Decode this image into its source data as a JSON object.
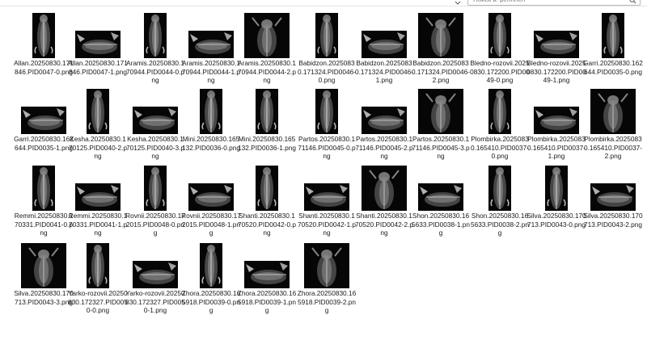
{
  "search": {
    "placeholder": "Поиск в: pennrien"
  },
  "files": [
    {
      "name": "Allan.20250830.171846.PID0047-0.png",
      "view": "v"
    },
    {
      "name": "Allan.20250830.171846.PID0047-1.png",
      "view": "h"
    },
    {
      "name": "Aramis.20250830.170944.PID0044-0.png",
      "view": "v"
    },
    {
      "name": "Aramis.20250830.170944.PID0044-1.png",
      "view": "h"
    },
    {
      "name": "Aramis.20250830.170944.PID0044-2.png",
      "view": "s"
    },
    {
      "name": "Babidzon.20250830.171324.PID0046-0.png",
      "view": "v"
    },
    {
      "name": "Babidzon.20250830.171324.PID0046-1.png",
      "view": "h"
    },
    {
      "name": "Babidzon.20250830.171324.PID0046-2.png",
      "view": "s"
    },
    {
      "name": "Bledno-rozovii.20250830.172200.PID0049-0.png",
      "view": "v"
    },
    {
      "name": "Bledno-rozovii.20250830.172200.PID0049-1.png",
      "view": "h"
    },
    {
      "name": "Garri.20250830.162644.PID0035-0.png",
      "view": "v"
    },
    {
      "name": "Garri.20250830.162644.PID0035-1.png",
      "view": "h"
    },
    {
      "name": "Kesha.20250830.170125.PID0040-2.png",
      "view": "v"
    },
    {
      "name": "Kesha.20250830.170125.PID0040-3.png",
      "view": "h"
    },
    {
      "name": "Mini.20250830.165132.PID0036-0.png",
      "view": "v"
    },
    {
      "name": "Mini.20250830.165132.PID0036-1.png",
      "view": "v"
    },
    {
      "name": "Partos.20250830.171146.PID0045-0.png",
      "view": "v"
    },
    {
      "name": "Partos.20250830.171146.PID0045-2.png",
      "view": "h"
    },
    {
      "name": "Partos.20250830.171146.PID0045-3.png",
      "view": "s"
    },
    {
      "name": "Plombirka.20250830.165410.PID0037-0.png",
      "view": "v"
    },
    {
      "name": "Plombirka.20250830.165410.PID0037-1.png",
      "view": "h"
    },
    {
      "name": "Plombirka.20250830.165410.PID0037-2.png",
      "view": "s"
    },
    {
      "name": "Remmi.20250830.170331.PID0041-0.png",
      "view": "v"
    },
    {
      "name": "Remmi.20250830.170331.PID0041-1.png",
      "view": "h"
    },
    {
      "name": "Rovnii.20250830.172015.PID0048-0.png",
      "view": "v"
    },
    {
      "name": "Rovnii.20250830.172015.PID0048-1.png",
      "view": "h"
    },
    {
      "name": "Shanti.20250830.170520.PID0042-0.png",
      "view": "v"
    },
    {
      "name": "Shanti.20250830.170520.PID0042-1.png",
      "view": "h"
    },
    {
      "name": "Shanti.20250830.170520.PID0042-2.png",
      "view": "s"
    },
    {
      "name": "Shon.20250830.165633.PID0038-1.png",
      "view": "h"
    },
    {
      "name": "Shon.20250830.165633.PID0038-2.png",
      "view": "v"
    },
    {
      "name": "Silva.20250830.170713.PID0043-0.png",
      "view": "v"
    },
    {
      "name": "Silva.20250830.170713.PID0043-2.png",
      "view": "h"
    },
    {
      "name": "Silva.20250830.170713.PID0043-3.png",
      "view": "s"
    },
    {
      "name": "Yarko-rozovii.20250830.172327.PID0050-0.png",
      "view": "v"
    },
    {
      "name": "Yarko-rozovii.20250830.172327.PID0050-1.png",
      "view": "h"
    },
    {
      "name": "Zhora.20250830.165918.PID0039-0.png",
      "view": "v"
    },
    {
      "name": "Zhora.20250830.165918.PID0039-1.png",
      "view": "h"
    },
    {
      "name": "Zhora.20250830.165918.PID0039-2.png",
      "view": "s"
    }
  ]
}
